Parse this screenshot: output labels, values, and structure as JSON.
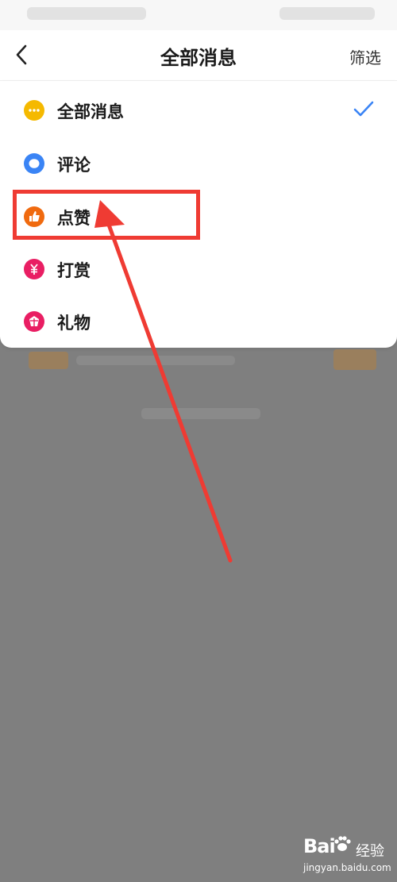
{
  "header": {
    "title": "全部消息",
    "filter_label": "筛选"
  },
  "menu": {
    "items": [
      {
        "label": "全部消息",
        "icon": "chat-bubble-icon",
        "color": "#f5b900",
        "selected": true
      },
      {
        "label": "评论",
        "icon": "comment-icon",
        "color": "#3a84f5",
        "selected": false
      },
      {
        "label": "点赞",
        "icon": "thumbs-up-icon",
        "color": "#f06a0f",
        "selected": false
      },
      {
        "label": "打赏",
        "icon": "yuan-icon",
        "color": "#e91e63",
        "selected": false
      },
      {
        "label": "礼物",
        "icon": "gift-icon",
        "color": "#e91e63",
        "selected": false
      }
    ],
    "check_color": "#3a84f5"
  },
  "annotation": {
    "color": "#ef3b33"
  },
  "watermark": {
    "brand": "Bai",
    "brand_suffix": "经验",
    "url": "jingyan.baidu.com"
  }
}
